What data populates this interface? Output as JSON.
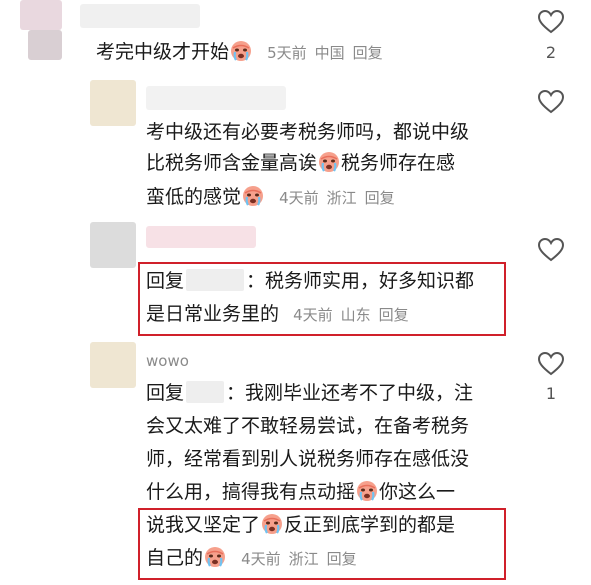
{
  "comments": [
    {
      "text_line1": "考完中级才开始",
      "time": "5天前",
      "location": "中国",
      "reply": "回复",
      "likes": "2"
    },
    {
      "line1": "考中级还有必要考税务师吗，都说中级",
      "line2a": "比税务师含金量高诶",
      "line2b": "税务师存在感",
      "line3": "蛮低的感觉",
      "time": "4天前",
      "location": "浙江",
      "reply": "回复",
      "likes": ""
    },
    {
      "reply_prefix": "回复",
      "line1": "：税务师实用，好多知识都",
      "line2": "是日常业务里的",
      "time": "4天前",
      "location": "山东",
      "reply": "回复",
      "likes": ""
    },
    {
      "username": "wowo",
      "reply_prefix": "回复",
      "line1": "：我刚毕业还考不了中级，注",
      "line2": "会又太难了不敢轻易尝试，在备考税务",
      "line3": "师，经常看到别人说税务师存在感低没",
      "line4a": "什么用，搞得我有点动摇",
      "line4b": "你这么一",
      "line5a": "说我又坚定了",
      "line5b": "反正到底学到的都是",
      "line6": "自己的",
      "time": "4天前",
      "location": "浙江",
      "reply": "回复",
      "likes": "1"
    }
  ],
  "colors": {
    "highlight": "#d0202a",
    "meta": "#8a8a8a"
  },
  "icons": [
    "heart-icon",
    "crying-emoji-icon"
  ]
}
